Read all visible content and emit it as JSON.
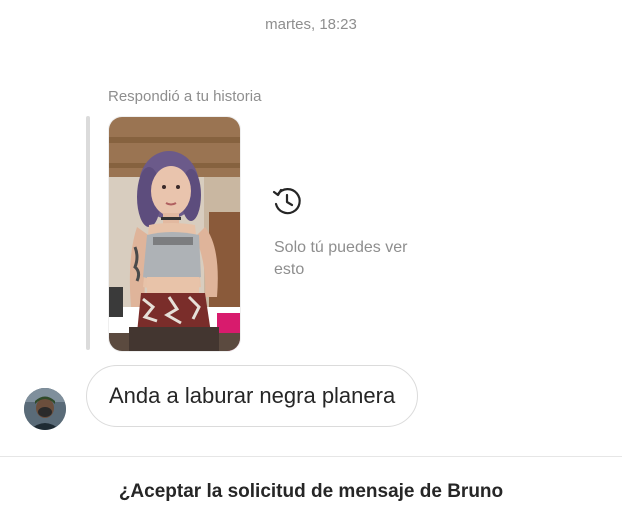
{
  "thread": {
    "timestamp": "martes, 18:23"
  },
  "story_reply": {
    "caption": "Respondió a tu historia",
    "private_note": "Solo tú puedes ver esto"
  },
  "message": {
    "text": "Anda a laburar negra planera"
  },
  "request": {
    "title": "¿Aceptar la solicitud de mensaje de Bruno"
  },
  "icons": {
    "history": "history-icon"
  },
  "colors": {
    "muted_text": "#8e8e8e",
    "bubble_border": "#dbdbdb",
    "text": "#262626"
  }
}
